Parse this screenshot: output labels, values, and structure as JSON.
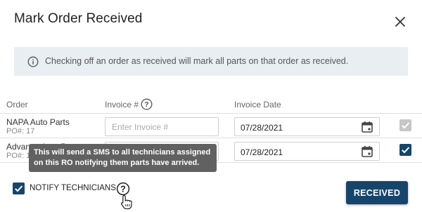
{
  "dialog": {
    "title": "Mark Order Received",
    "close_icon": "close-icon"
  },
  "info": {
    "icon": "info-icon",
    "text": "Checking off an order as received will mark all parts on that order as received."
  },
  "table": {
    "columns": {
      "order": "Order",
      "invoice": "Invoice #",
      "invoice_date": "Invoice Date"
    },
    "rows": [
      {
        "vendor": "NAPA Auto Parts",
        "po": "PO#: 17",
        "invoice_placeholder": "Enter Invoice #",
        "invoice_value": "",
        "date": "07/28/2021",
        "received_checked": true,
        "received_disabled": true
      },
      {
        "vendor": "Advance Auto Parts",
        "po": "PO#: 18",
        "invoice_placeholder": "Enter Invoice #",
        "invoice_value": "",
        "date": "07/28/2021",
        "received_checked": true,
        "received_disabled": false
      }
    ]
  },
  "tooltip": {
    "line1": "This will send a SMS to all technicians assigned",
    "line2": "on this RO notifying them parts have arrived."
  },
  "notify": {
    "label": "NOTIFY TECHNICIANS",
    "checked": true
  },
  "actions": {
    "received_label": "RECEIVED"
  },
  "colors": {
    "primary": "#16456b",
    "info_bg": "#e9eef2",
    "tooltip_bg": "#616161",
    "disabled_check": "#c6c6c6"
  }
}
